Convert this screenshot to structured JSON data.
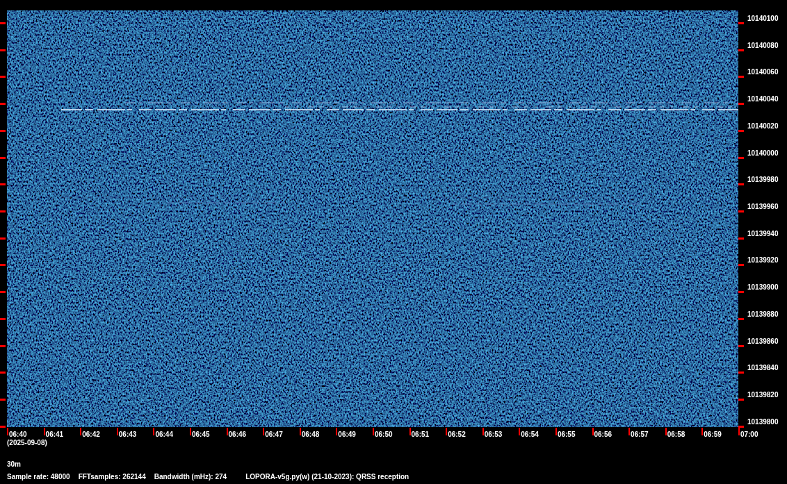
{
  "spectrogram": {
    "frequency_labels": [
      "10140100",
      "10140080",
      "10140060",
      "10140040",
      "10140020",
      "10140000",
      "10139980",
      "10139960",
      "10139940",
      "10139920",
      "10139900",
      "10139880",
      "10139860",
      "10139840",
      "10139820",
      "10139800"
    ],
    "time_labels": [
      "06:40",
      "06:41",
      "06:42",
      "06:43",
      "06:44",
      "06:45",
      "06:46",
      "06:47",
      "06:48",
      "06:49",
      "06:50",
      "06:51",
      "06:52",
      "06:53",
      "06:54",
      "06:55",
      "06:56",
      "06:57",
      "06:58",
      "06:59",
      "07:00"
    ],
    "date": "(2025-09-08)"
  },
  "band": "30m",
  "info": [
    "Sample rate: 48000",
    "FFTsamples: 262144",
    "Bandwidth (mHz): 274",
    "LOPORA-v5g.py(w) (21-10-2023): QRSS reception"
  ]
}
